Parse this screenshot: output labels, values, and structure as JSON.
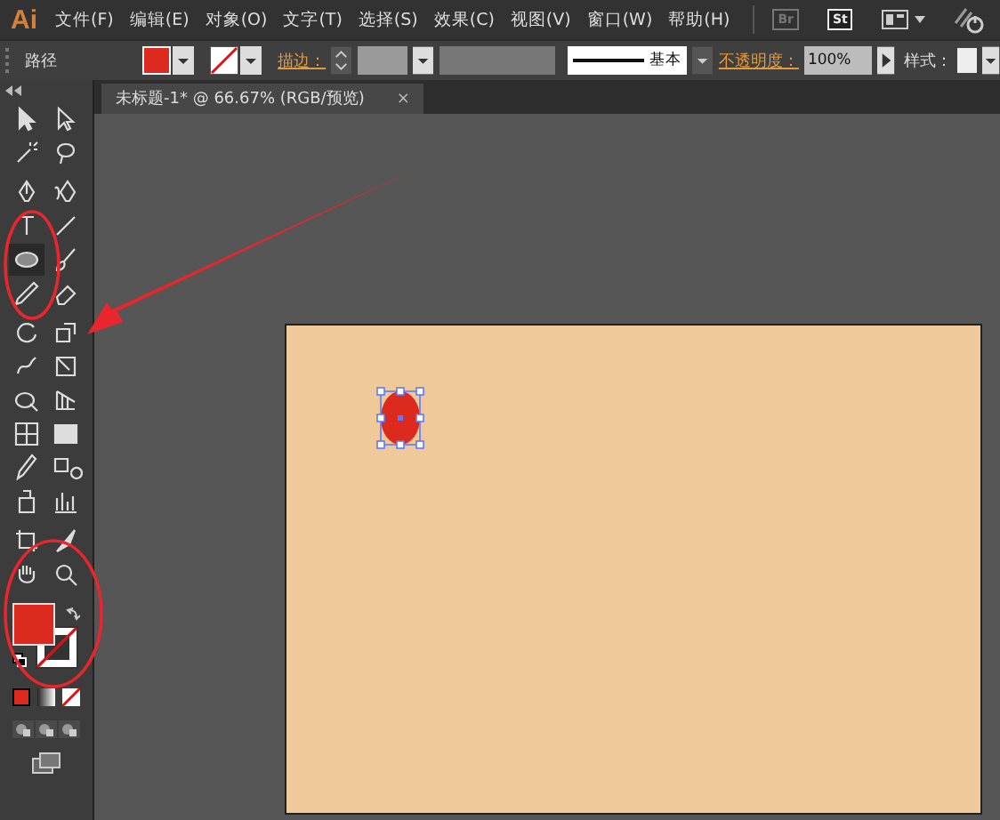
{
  "app_logo": "Ai",
  "menu": [
    "文件(F)",
    "编辑(E)",
    "对象(O)",
    "文字(T)",
    "选择(S)",
    "效果(C)",
    "视图(V)",
    "窗口(W)",
    "帮助(H)"
  ],
  "bridge_buttons": [
    "Br",
    "St"
  ],
  "control_bar": {
    "object_type": "路径",
    "stroke_label": "描边：",
    "brush": "基本",
    "opacity_label": "不透明度：",
    "opacity": "100%",
    "style_label": "样式："
  },
  "document_tab": {
    "title": "未标题-1* @ 66.67% (RGB/预览)",
    "close": "×"
  },
  "tools": [
    {
      "kind": "selection",
      "selected": false
    },
    {
      "kind": "direct-selection",
      "selected": false
    },
    {
      "kind": "magic-wand",
      "selected": false
    },
    {
      "kind": "lasso",
      "selected": false
    },
    {
      "kind": "pen",
      "selected": false
    },
    {
      "kind": "curvature",
      "selected": false
    },
    {
      "kind": "type",
      "selected": false
    },
    {
      "kind": "line",
      "selected": false
    },
    {
      "kind": "ellipse",
      "selected": true
    },
    {
      "kind": "paintbrush",
      "selected": false
    },
    {
      "kind": "pencil",
      "selected": false
    },
    {
      "kind": "eraser",
      "selected": false
    },
    {
      "kind": "rotate",
      "selected": false
    },
    {
      "kind": "scale",
      "selected": false
    },
    {
      "kind": "warp",
      "selected": false
    },
    {
      "kind": "free-transform",
      "selected": false
    },
    {
      "kind": "shape-builder",
      "selected": false
    },
    {
      "kind": "perspective",
      "selected": false
    },
    {
      "kind": "mesh",
      "selected": false
    },
    {
      "kind": "gradient",
      "selected": false
    },
    {
      "kind": "eyedropper",
      "selected": false
    },
    {
      "kind": "blend",
      "selected": false
    },
    {
      "kind": "symbol-sprayer",
      "selected": false
    },
    {
      "kind": "graph",
      "selected": false
    },
    {
      "kind": "artboard",
      "selected": false
    },
    {
      "kind": "slice",
      "selected": false
    },
    {
      "kind": "hand",
      "selected": false
    },
    {
      "kind": "zoom",
      "selected": false
    }
  ],
  "fill_swatch": {
    "color": "#dc2a1f"
  },
  "artboard": {
    "shape": {
      "kind": "ellipse",
      "color": "#dc2a1f",
      "selected": true
    }
  }
}
